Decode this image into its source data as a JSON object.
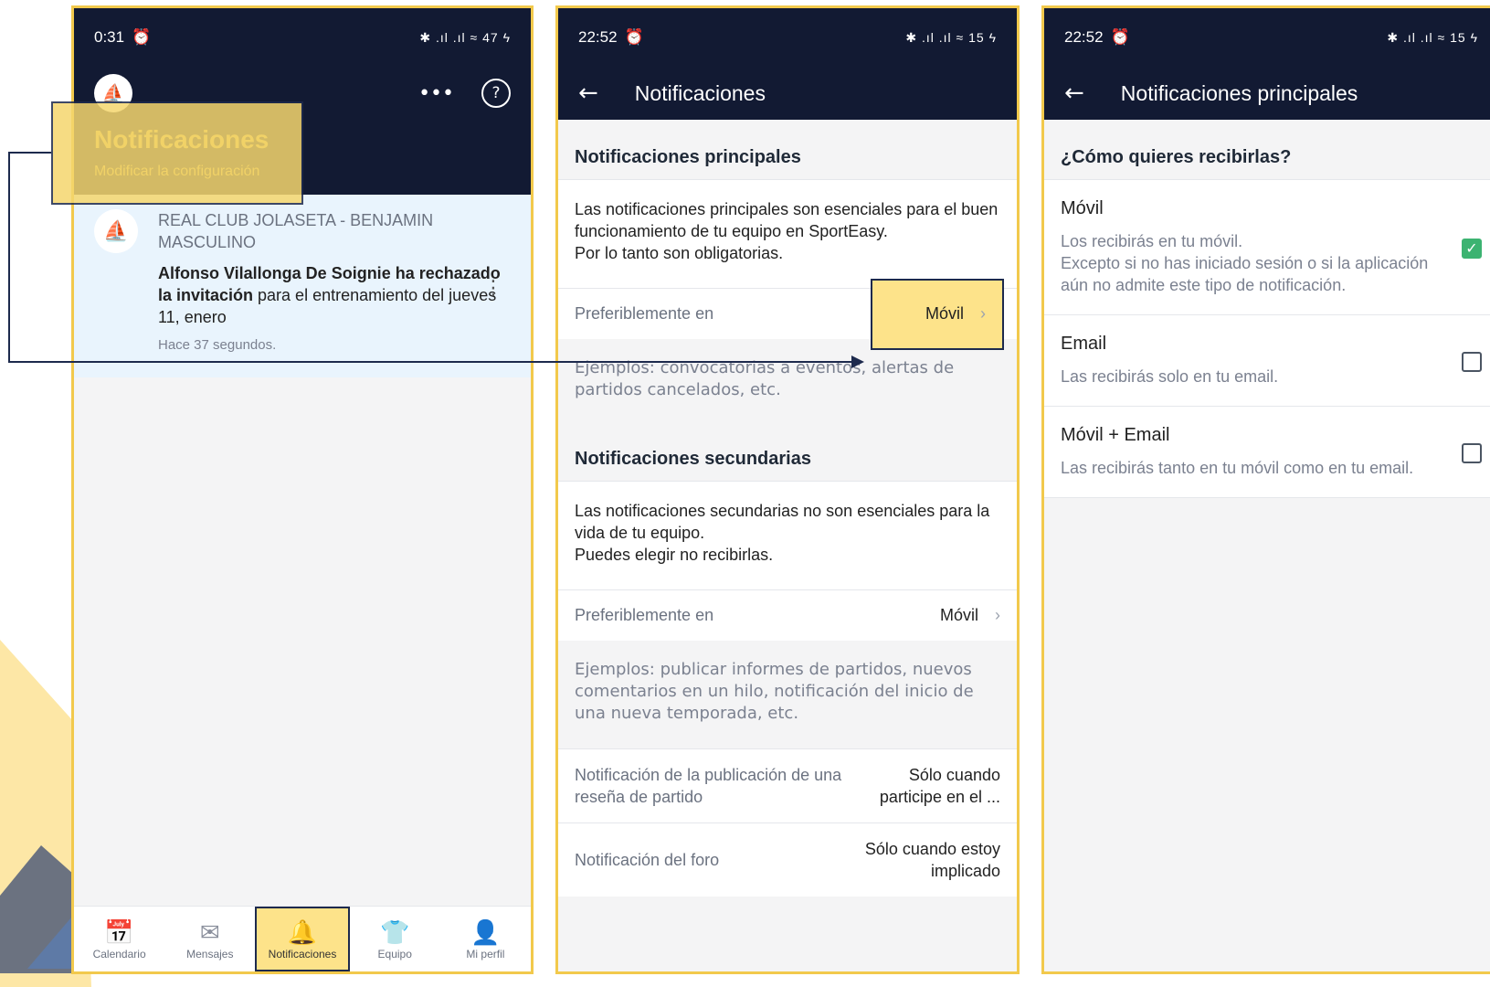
{
  "screen1": {
    "status": {
      "time": "0:31",
      "right": "✱ .ıl .ıl ≈ 47 ϟ"
    },
    "header": {
      "title": "Notificaciones",
      "subtitle": "Modificar la configuración"
    },
    "notification": {
      "club": "REAL CLUB JOLASETA - BENJAMIN MASCULINO",
      "message_bold": "Alfonso Vilallonga De Soignie ha rechazado la invitación",
      "message_rest": " para el entrenamiento del jueves 11, enero",
      "time_ago": "Hace 37 segundos."
    },
    "tabs": [
      {
        "label": "Calendario",
        "icon": "calendar-icon"
      },
      {
        "label": "Mensajes",
        "icon": "mail-icon"
      },
      {
        "label": "Notificaciones",
        "icon": "bell-icon"
      },
      {
        "label": "Equipo",
        "icon": "shirt-icon"
      },
      {
        "label": "Mi perfil",
        "icon": "user-icon"
      }
    ]
  },
  "screen2": {
    "status": {
      "time": "22:52",
      "right": "✱ .ıl .ıl ≈ 15 ϟ"
    },
    "title": "Notificaciones",
    "principal": {
      "heading": "Notificaciones principales",
      "desc": "Las notificaciones principales son esenciales para el buen funcionamiento de tu equipo en SportEasy.\nPor lo tanto son obligatorias.",
      "pref_label": "Preferiblemente en",
      "pref_value": "Móvil",
      "examples": "Ejemplos: convocatorias a eventos, alertas de partidos cancelados, etc."
    },
    "secondary": {
      "heading": "Notificaciones secundarias",
      "desc": "Las notificaciones secundarias no son esenciales para la vida de tu equipo.\nPuedes elegir no recibirlas.",
      "pref_label": "Preferiblemente en",
      "pref_value": "Móvil",
      "examples": "Ejemplos: publicar informes de partidos, nuevos comentarios en un hilo, notificación del inicio de una nueva temporada, etc."
    },
    "review_row": {
      "label": "Notificación de la publicación de una reseña de partido",
      "value": "Sólo cuando participe en el ..."
    },
    "forum_row": {
      "label": "Notificación del foro",
      "value": "Sólo cuando estoy implicado"
    }
  },
  "screen3": {
    "status": {
      "time": "22:52",
      "right": "✱ .ıl .ıl ≈ 15 ϟ"
    },
    "title": "Notificaciones principales",
    "question": "¿Cómo quieres recibirlas?",
    "options": [
      {
        "name": "Móvil",
        "desc": "Los recibirás en tu móvil.\nExcepto si no has iniciado sesión o si la aplicación aún no admite este tipo de notificación.",
        "checked": true
      },
      {
        "name": "Email",
        "desc": "Las recibirás solo en tu email.",
        "checked": false
      },
      {
        "name": "Móvil + Email",
        "desc": "Las recibirás tanto en tu móvil como en tu email.",
        "checked": false
      }
    ]
  },
  "colors": {
    "navy": "#121a33",
    "highlight": "#fde38a",
    "accent": "#e0b940",
    "check": "#3cb371"
  }
}
